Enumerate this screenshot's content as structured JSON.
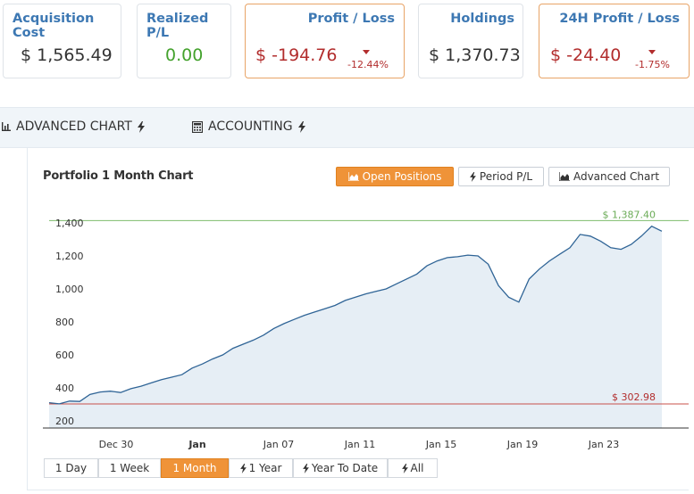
{
  "stats": {
    "acquisition_cost": {
      "label": "Acquisition Cost",
      "value": "$ 1,565.49"
    },
    "realized_pl": {
      "label": "Realized P/L",
      "value": "0.00"
    },
    "profit_loss": {
      "label": "Profit / Loss",
      "value": "$ -194.76",
      "pct": "-12.44%"
    },
    "holdings": {
      "label": "Holdings",
      "value": "$ 1,370.73"
    },
    "profit_24h": {
      "label": "24H Profit / Loss",
      "value": "$ -24.40",
      "pct": "-1.75%"
    }
  },
  "tabs": {
    "advanced_chart": "ADVANCED CHART",
    "accounting": "ACCOUNTING"
  },
  "panel": {
    "title": "Portfolio 1 Month Chart",
    "buttons": {
      "open_positions": "Open Positions",
      "period_pl": "Period P/L",
      "advanced_chart": "Advanced Chart"
    },
    "ranges": [
      "1 Day",
      "1 Week",
      "1 Month",
      "1 Year",
      "Year To Date",
      "All"
    ],
    "active_range": "1 Month"
  },
  "colors": {
    "accent": "#ef9338",
    "label_blue": "#3d78b3",
    "loss_red": "#b22d2d",
    "gain_green": "#44a22d",
    "line": "#2f6496",
    "area": "#e6eef5"
  },
  "chart_data": {
    "type": "area",
    "title": "",
    "xlabel": "",
    "ylabel": "",
    "ylim": [
      200,
      1400
    ],
    "yticks": [
      "200",
      "400",
      "600",
      "800",
      "1,000",
      "1,200",
      "1,400"
    ],
    "xticks": [
      "Dec 30",
      "Jan",
      "Jan 07",
      "Jan 11",
      "Jan 15",
      "Jan 19",
      "Jan 23"
    ],
    "bold_xtick": "Jan",
    "max_label": "$ 1,387.40",
    "min_label": "$ 302.98",
    "max_value": 1387.4,
    "min_value": 302.98,
    "x": [
      "Dec 26",
      "Dec 26",
      "Dec 27",
      "Dec 27",
      "Dec 28",
      "Dec 28",
      "Dec 29",
      "Dec 29",
      "Dec 30",
      "Dec 30",
      "Dec 31",
      "Dec 31",
      "Jan 01",
      "Jan 01",
      "Jan 02",
      "Jan 02",
      "Jan 03",
      "Jan 03",
      "Jan 04",
      "Jan 04",
      "Jan 05",
      "Jan 05",
      "Jan 06",
      "Jan 06",
      "Jan 07",
      "Jan 07",
      "Jan 08",
      "Jan 08",
      "Jan 09",
      "Jan 09",
      "Jan 10",
      "Jan 10",
      "Jan 11",
      "Jan 11",
      "Jan 12",
      "Jan 12",
      "Jan 13",
      "Jan 13",
      "Jan 14",
      "Jan 14",
      "Jan 15",
      "Jan 15",
      "Jan 16",
      "Jan 16",
      "Jan 17",
      "Jan 17",
      "Jan 18",
      "Jan 18",
      "Jan 19",
      "Jan 19",
      "Jan 20",
      "Jan 20",
      "Jan 21",
      "Jan 21",
      "Jan 22",
      "Jan 22",
      "Jan 23",
      "Jan 23",
      "Jan 24",
      "Jan 24",
      "Jan 25"
    ],
    "values": [
      310,
      303,
      320,
      318,
      360,
      375,
      380,
      372,
      395,
      410,
      430,
      450,
      465,
      480,
      520,
      545,
      575,
      600,
      640,
      665,
      690,
      720,
      760,
      790,
      815,
      840,
      860,
      880,
      900,
      930,
      950,
      970,
      985,
      1000,
      1030,
      1060,
      1090,
      1140,
      1170,
      1190,
      1195,
      1205,
      1200,
      1150,
      1020,
      950,
      920,
      1060,
      1120,
      1170,
      1210,
      1250,
      1330,
      1320,
      1290,
      1250,
      1240,
      1270,
      1320,
      1380,
      1350
    ]
  }
}
